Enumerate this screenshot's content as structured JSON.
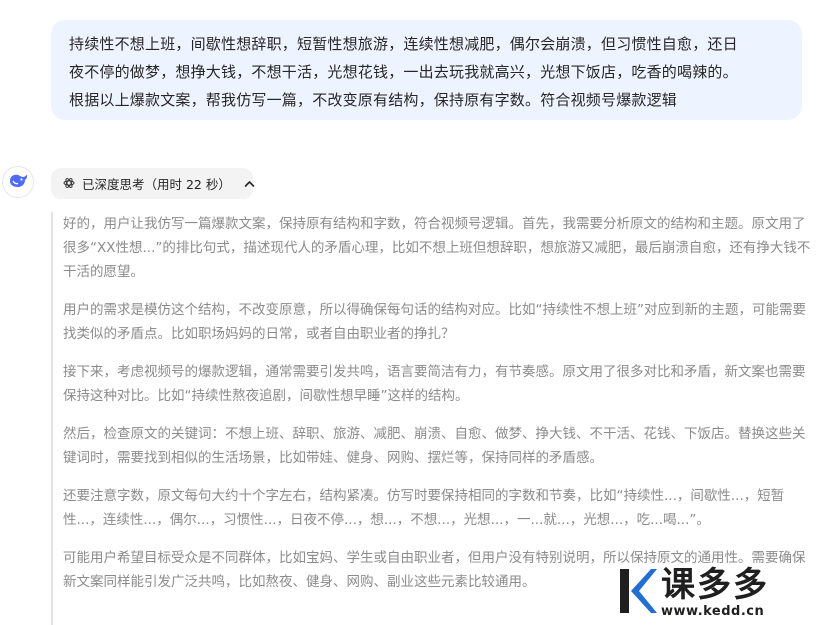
{
  "user_message": {
    "lines": [
      "持续性不想上班，间歇性想辞职，短暂性想旅游，连续性想减肥，偶尔会崩溃，但习惯性自愈，还日",
      "夜不停的做梦，想挣大钱，不想干活，光想花钱，一出去玩我就高兴，光想下饭店，吃香的喝辣的。",
      "根据以上爆款文案，帮我仿写一篇，不改变原有结构，保持原有字数。符合视频号爆款逻辑"
    ]
  },
  "assistant": {
    "avatar_icon": "deepseek-whale-icon",
    "thinking_toggle": {
      "icon": "atom-icon",
      "label": "已深度思考（用时 22 秒）",
      "chevron": "chevron-up-icon"
    },
    "thought_paragraphs": [
      "好的，用户让我仿写一篇爆款文案，保持原有结构和字数，符合视频号逻辑。首先，我需要分析原文的结构和主题。原文用了很多“XX性想...”的排比句式，描述现代人的矛盾心理，比如不想上班但想辞职，想旅游又减肥，最后崩溃自愈，还有挣大钱不干活的愿望。",
      "用户的需求是模仿这个结构，不改变原意，所以得确保每句话的结构对应。比如“持续性不想上班”对应到新的主题，可能需要找类似的矛盾点。比如职场妈妈的日常，或者自由职业者的挣扎？",
      "接下来，考虑视频号的爆款逻辑，通常需要引发共鸣，语言要简洁有力，有节奏感。原文用了很多对比和矛盾，新文案也需要保持这种对比。比如“持续性熬夜追剧，间歇性想早睡”这样的结构。",
      "然后，检查原文的关键词：不想上班、辞职、旅游、减肥、崩溃、自愈、做梦、挣大钱、不干活、花钱、下饭店。替换这些关键词时，需要找到相似的生活场景，比如带娃、健身、网购、摆烂等，保持同样的矛盾感。",
      "还要注意字数，原文每句大约十个字左右，结构紧凑。仿写时要保持相同的字数和节奏，比如“持续性...，间歇性...，短暂性...，连续性...，偶尔...，习惯性...，日夜不停...，想...，不想...，光想...，一...就...，光想...，吃...喝...”。",
      "可能用户希望目标受众是不同群体，比如宝妈、学生或自由职业者，但用户没有特别说明，所以保持原文的通用性。需要确保新文案同样能引发广泛共鸣，比如熬夜、健身、网购、副业这些元素比较通用。"
    ]
  },
  "watermark": {
    "name": "课多多",
    "url": "www.kedd.cn",
    "colors": {
      "k_blue": "#1f6fd6",
      "k_dark": "#1f1f1f"
    }
  }
}
